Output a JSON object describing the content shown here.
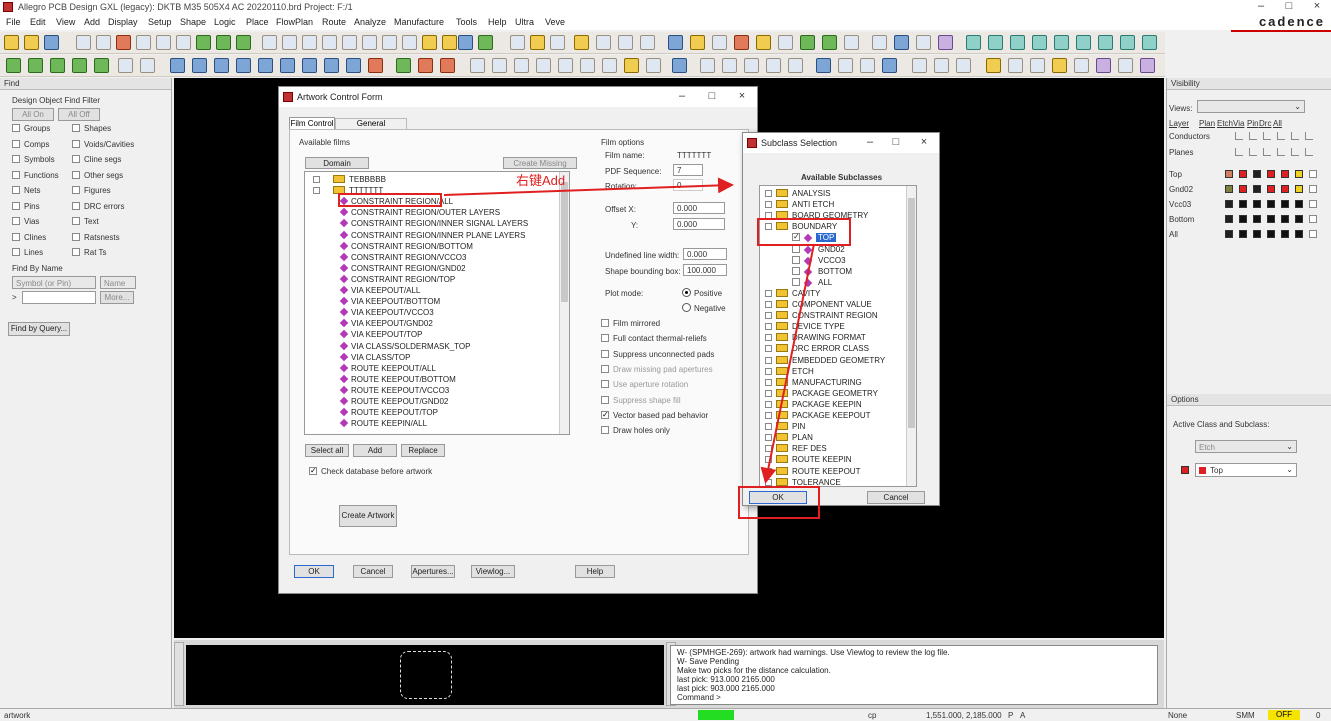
{
  "app": {
    "title": "Allegro PCB Design GXL (legacy): DKTB M35 505X4 AC 20220110.brd  Project: F:/1",
    "brand": "cadence",
    "menus": [
      "File",
      "Edit",
      "View",
      "Add",
      "Display",
      "Setup",
      "Shape",
      "Logic",
      "Place",
      "FlowPlan",
      "Route",
      "Analyze",
      "Manufacture",
      "Tools",
      "Help",
      "Ultra",
      "Veve"
    ]
  },
  "find_panel": {
    "header": "Find",
    "section_label": "Design Object Find Filter",
    "all_on": "All On",
    "all_off": "All Off",
    "left_items": [
      "Groups",
      "Comps",
      "Symbols",
      "Functions",
      "Nets",
      "Pins",
      "Vias",
      "Clines",
      "Lines"
    ],
    "right_items": [
      "Shapes",
      "Voids/Cavities",
      "Cline segs",
      "Other segs",
      "Figures",
      "DRC errors",
      "Text",
      "Ratsnests",
      "Rat Ts"
    ],
    "find_by_name": "Find By Name",
    "symbol_pin": "Symbol (or Pin)",
    "name": "Name",
    "more": "More...",
    "find_by_query": "Find by Query..."
  },
  "artwork": {
    "title": "Artwork Control Form",
    "tabs": [
      "Film Control",
      "General Parameters"
    ],
    "available_films": "Available films",
    "domain_selection": "Domain Selection",
    "create_missing": "Create Missing Films",
    "films": [
      {
        "label": "TEBBBBB",
        "type": "folder",
        "indent": 1
      },
      {
        "label": "TTTTTTT",
        "type": "folder-open",
        "indent": 1
      },
      {
        "label": "CONSTRAINT REGION/ALL",
        "type": "item",
        "indent": 2
      },
      {
        "label": "CONSTRAINT REGION/OUTER LAYERS",
        "type": "item",
        "indent": 2
      },
      {
        "label": "CONSTRAINT REGION/INNER SIGNAL LAYERS",
        "type": "item",
        "indent": 2
      },
      {
        "label": "CONSTRAINT REGION/INNER PLANE LAYERS",
        "type": "item",
        "indent": 2
      },
      {
        "label": "CONSTRAINT REGION/BOTTOM",
        "type": "item",
        "indent": 2
      },
      {
        "label": "CONSTRAINT REGION/VCCO3",
        "type": "item",
        "indent": 2
      },
      {
        "label": "CONSTRAINT REGION/GND02",
        "type": "item",
        "indent": 2
      },
      {
        "label": "CONSTRAINT REGION/TOP",
        "type": "item",
        "indent": 2
      },
      {
        "label": "VIA KEEPOUT/ALL",
        "type": "item",
        "indent": 2
      },
      {
        "label": "VIA KEEPOUT/BOTTOM",
        "type": "item",
        "indent": 2
      },
      {
        "label": "VIA KEEPOUT/VCCO3",
        "type": "item",
        "indent": 2
      },
      {
        "label": "VIA KEEPOUT/GND02",
        "type": "item",
        "indent": 2
      },
      {
        "label": "VIA KEEPOUT/TOP",
        "type": "item",
        "indent": 2
      },
      {
        "label": "VIA CLASS/SOLDERMASK_TOP",
        "type": "item",
        "indent": 2
      },
      {
        "label": "VIA CLASS/TOP",
        "type": "item",
        "indent": 2
      },
      {
        "label": "ROUTE KEEPOUT/ALL",
        "type": "item",
        "indent": 2
      },
      {
        "label": "ROUTE KEEPOUT/BOTTOM",
        "type": "item",
        "indent": 2
      },
      {
        "label": "ROUTE KEEPOUT/VCCO3",
        "type": "item",
        "indent": 2
      },
      {
        "label": "ROUTE KEEPOUT/GND02",
        "type": "item",
        "indent": 2
      },
      {
        "label": "ROUTE KEEPOUT/TOP",
        "type": "item",
        "indent": 2
      },
      {
        "label": "ROUTE KEEPIN/ALL",
        "type": "item",
        "indent": 2
      }
    ],
    "film_options": "Film options",
    "film_name_label": "Film name:",
    "film_name_value": "TTTTTTT",
    "pdf_sequence_label": "PDF Sequence:",
    "pdf_sequence_value": "7",
    "rotation_label": "Rotation:",
    "rotation_value": "0",
    "offset_x_label": "Offset  X:",
    "offset_x_value": "0.000",
    "offset_y_label": "Y:",
    "offset_y_value": "0.000",
    "undefined_line_width_label": "Undefined line width:",
    "undefined_line_width_value": "0.000",
    "shape_bounding_box_label": "Shape bounding box:",
    "shape_bounding_box_value": "100.000",
    "plot_mode_label": "Plot mode:",
    "positive": "Positive",
    "negative": "Negative",
    "film_options_checks": [
      "Film mirrored",
      "Full contact thermal-reliefs",
      "Suppress unconnected pads",
      "Draw missing pad apertures",
      "Use aperture rotation",
      "Suppress shape fill",
      "Vector based pad behavior",
      "Draw holes only"
    ],
    "select_all": "Select all",
    "add": "Add",
    "replace": "Replace",
    "check_db": "Check database before artwork",
    "create_artwork": "Create Artwork",
    "bottom_buttons": [
      "OK",
      "Cancel",
      "Apertures...",
      "Viewlog...",
      "Help"
    ]
  },
  "annotation": {
    "text": "右键Add",
    "color": "#e02020"
  },
  "subclass": {
    "title": "Subclass Selection",
    "heading": "Available Subclasses",
    "items": [
      {
        "label": "ANALYSIS",
        "level": 0,
        "type": "folder"
      },
      {
        "label": "ANTI ETCH",
        "level": 0,
        "type": "folder"
      },
      {
        "label": "BOARD GEOMETRY",
        "level": 0,
        "type": "folder"
      },
      {
        "label": "BOUNDARY",
        "level": 0,
        "type": "folder-open"
      },
      {
        "label": "TOP",
        "level": 1,
        "type": "check",
        "checked": true,
        "selected": true
      },
      {
        "label": "GND02",
        "level": 1,
        "type": "check",
        "checked": false
      },
      {
        "label": "VCCO3",
        "level": 1,
        "type": "check",
        "checked": false
      },
      {
        "label": "BOTTOM",
        "level": 1,
        "type": "check",
        "checked": false
      },
      {
        "label": "ALL",
        "level": 1,
        "type": "check",
        "checked": false
      },
      {
        "label": "CAVITY",
        "level": 0,
        "type": "folder"
      },
      {
        "label": "COMPONENT VALUE",
        "level": 0,
        "type": "folder"
      },
      {
        "label": "CONSTRAINT REGION",
        "level": 0,
        "type": "folder"
      },
      {
        "label": "DEVICE TYPE",
        "level": 0,
        "type": "folder"
      },
      {
        "label": "DRAWING FORMAT",
        "level": 0,
        "type": "folder"
      },
      {
        "label": "DRC ERROR CLASS",
        "level": 0,
        "type": "folder"
      },
      {
        "label": "EMBEDDED GEOMETRY",
        "level": 0,
        "type": "folder"
      },
      {
        "label": "ETCH",
        "level": 0,
        "type": "folder"
      },
      {
        "label": "MANUFACTURING",
        "level": 0,
        "type": "folder"
      },
      {
        "label": "PACKAGE GEOMETRY",
        "level": 0,
        "type": "folder"
      },
      {
        "label": "PACKAGE KEEPIN",
        "level": 0,
        "type": "folder"
      },
      {
        "label": "PACKAGE KEEPOUT",
        "level": 0,
        "type": "folder"
      },
      {
        "label": "PIN",
        "level": 0,
        "type": "folder"
      },
      {
        "label": "PLAN",
        "level": 0,
        "type": "folder"
      },
      {
        "label": "REF DES",
        "level": 0,
        "type": "folder"
      },
      {
        "label": "ROUTE KEEPIN",
        "level": 0,
        "type": "folder"
      },
      {
        "label": "ROUTE KEEPOUT",
        "level": 0,
        "type": "folder"
      },
      {
        "label": "TOLERANCE",
        "level": 0,
        "type": "folder"
      }
    ],
    "ok": "OK",
    "cancel": "Cancel"
  },
  "visibility": {
    "header": "Visibility",
    "views_label": "Views:",
    "cols": [
      "Layer",
      "Plan",
      "Etch",
      "Via",
      "Pin",
      "Drc",
      "All"
    ],
    "conductors": "Conductors",
    "planes": "Planes",
    "layers": [
      {
        "name": "Top",
        "color": "#d08060"
      },
      {
        "name": "Gnd02",
        "color": "#808040"
      },
      {
        "name": "Vcc03",
        "color": "#202020"
      },
      {
        "name": "Bottom",
        "color": "#202020"
      },
      {
        "name": "All",
        "color": "#202020"
      }
    ]
  },
  "options": {
    "header": "Options",
    "active_label": "Active Class and Subclass:",
    "class_value": "Etch",
    "subclass_value": "Top",
    "subclass_color": "#e02020"
  },
  "command_log": [
    "W- (SPMHGE-269): artwork had warnings. Use Viewlog to review the log file.",
    "W- Save Pending",
    "Make two picks for the distance calculation.",
    "last pick:  913.000 2165.000",
    "last pick:  903.000 2165.000",
    "Command >"
  ],
  "status": {
    "left": "artwork",
    "mode": "cp",
    "coords": "1,551.000, 2,185.000",
    "p": "P",
    "a": "A",
    "none": "None",
    "smm": "SMM",
    "off": "OFF",
    "zero": "0"
  }
}
